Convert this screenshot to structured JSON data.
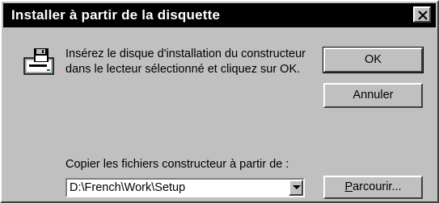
{
  "window": {
    "title": "Installer à partir de la disquette",
    "close_icon": "close-icon"
  },
  "message": {
    "icon": "floppy-drive-icon",
    "line1": "Insérez le disque d'installation du constructeur",
    "line2": "dans le lecteur sélectionné et cliquez sur OK."
  },
  "buttons": {
    "ok_label": "OK",
    "cancel_label": "Annuler",
    "browse_mnemonic": "P",
    "browse_rest": "arcourir..."
  },
  "copy_from": {
    "label": "Copier les fichiers constructeur à partir de :",
    "value": "D:\\French\\Work\\Setup",
    "dropdown_icon": "chevron-down-icon"
  }
}
